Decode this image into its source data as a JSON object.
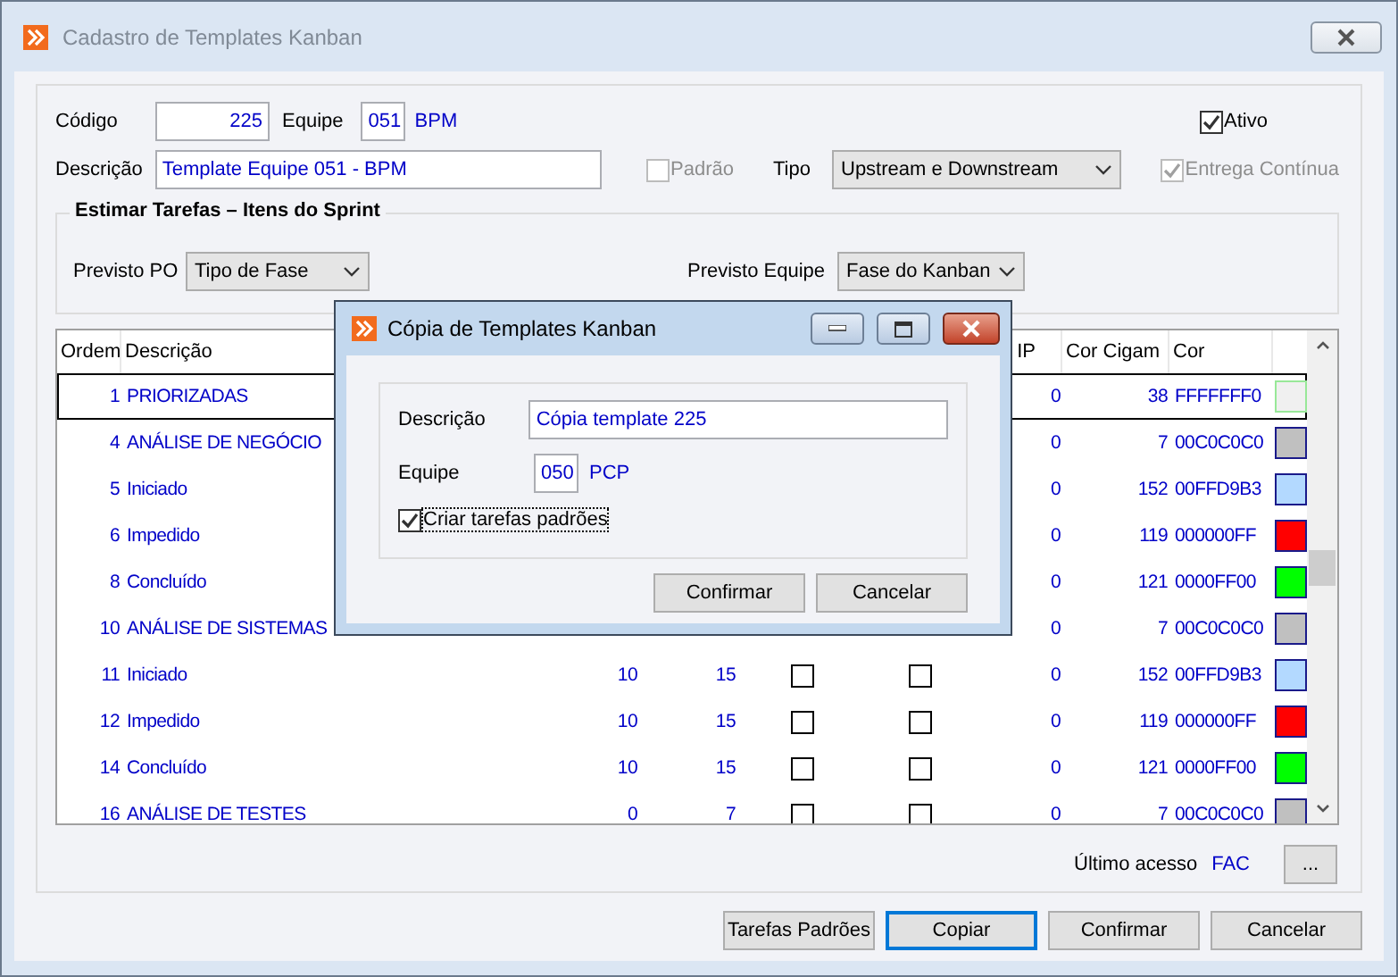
{
  "window": {
    "title": "Cadastro de Templates Kanban"
  },
  "form": {
    "codigo_label": "Código",
    "codigo": "225",
    "equipe_label": "Equipe",
    "equipe_code": "051",
    "equipe_name": "BPM",
    "ativo": {
      "label": "Ativo",
      "checked": true,
      "disabled": false
    },
    "descricao_label": "Descrição",
    "descricao": "Template Equipe 051 - BPM",
    "padrao": {
      "label": "Padrão",
      "checked": false,
      "disabled": true
    },
    "tipo_label": "Tipo",
    "tipo": "Upstream e Downstream",
    "entrega_continua": {
      "label": "Entrega Contínua",
      "checked": true,
      "disabled": true
    }
  },
  "estimar": {
    "title": "Estimar Tarefas – Itens do Sprint",
    "previsto_po_label": "Previsto PO",
    "previsto_po": "Tipo de Fase",
    "previsto_equipe_label": "Previsto Equipe",
    "previsto_equipe": "Fase do Kanban"
  },
  "table": {
    "columns": {
      "ordem": "Ordem",
      "descricao": "Descrição",
      "column_7": "IP",
      "cor_cigam": "Cor Cigam",
      "cor": "Cor"
    },
    "rows": [
      {
        "ordem": "1",
        "descricao": "PRIORIZADAS",
        "column_7": "0",
        "cor_cigam": "38",
        "cor": "FFFFFFF0",
        "color": "#f0f0f0",
        "selected": true
      },
      {
        "ordem": "4",
        "descricao": "ANÁLISE DE NEGÓCIO",
        "column_7": "0",
        "cor_cigam": "7",
        "cor": "00C0C0C0",
        "color": "#c0c0c0",
        "selected": false
      },
      {
        "ordem": "5",
        "descricao": "Iniciado",
        "column_7": "0",
        "cor_cigam": "152",
        "cor": "00FFD9B3",
        "color": "#b3d9ff",
        "selected": false
      },
      {
        "ordem": "6",
        "descricao": "Impedido",
        "column_7": "0",
        "cor_cigam": "119",
        "cor": "000000FF",
        "color": "#ff0000",
        "selected": false
      },
      {
        "ordem": "8",
        "descricao": "Concluído",
        "column_7": "0",
        "cor_cigam": "121",
        "cor": "0000FF00",
        "color": "#00ff00",
        "selected": false
      },
      {
        "ordem": "10",
        "descricao": "ANÁLISE DE SISTEMAS",
        "column_7": "0",
        "cor_cigam": "7",
        "cor": "00C0C0C0",
        "color": "#c0c0c0",
        "selected": false
      },
      {
        "ordem": "11",
        "descricao": "Iniciado",
        "column_3": "10",
        "column_4": "15",
        "column_5": false,
        "column_6": false,
        "column_7": "0",
        "cor_cigam": "152",
        "cor": "00FFD9B3",
        "color": "#b3d9ff",
        "selected": false
      },
      {
        "ordem": "12",
        "descricao": "Impedido",
        "column_3": "10",
        "column_4": "15",
        "column_5": false,
        "column_6": false,
        "column_7": "0",
        "cor_cigam": "119",
        "cor": "000000FF",
        "color": "#ff0000",
        "selected": false
      },
      {
        "ordem": "14",
        "descricao": "Concluído",
        "column_3": "10",
        "column_4": "15",
        "column_5": false,
        "column_6": false,
        "column_7": "0",
        "cor_cigam": "121",
        "cor": "0000FF00",
        "color": "#00ff00",
        "selected": false
      },
      {
        "ordem": "16",
        "descricao": "ANÁLISE DE TESTES",
        "column_3": "0",
        "column_4": "7",
        "column_5": false,
        "column_6": false,
        "column_7": "0",
        "cor_cigam": "7",
        "cor": "00C0C0C0",
        "color": "#c0c0c0",
        "selected": false
      }
    ]
  },
  "footer": {
    "ultimo_acesso_label": "Último acesso",
    "ultimo_acesso": "FAC",
    "more_button": "..."
  },
  "buttons": [
    {
      "label": "Tarefas Padrões",
      "focused": false
    },
    {
      "label": "Copiar",
      "focused": true
    },
    {
      "label": "Confirmar",
      "focused": false
    },
    {
      "label": "Cancelar",
      "focused": false
    }
  ],
  "dialog": {
    "title": "Cópia de Templates Kanban",
    "descricao_label": "Descrição",
    "descricao": "Cópia template 225",
    "equipe_label": "Equipe",
    "equipe_code": "050",
    "equipe_name": "PCP",
    "criar_tarefas": {
      "label": "Criar tarefas padrões",
      "checked": true
    },
    "buttons": [
      "Confirmar",
      "Cancelar"
    ]
  }
}
